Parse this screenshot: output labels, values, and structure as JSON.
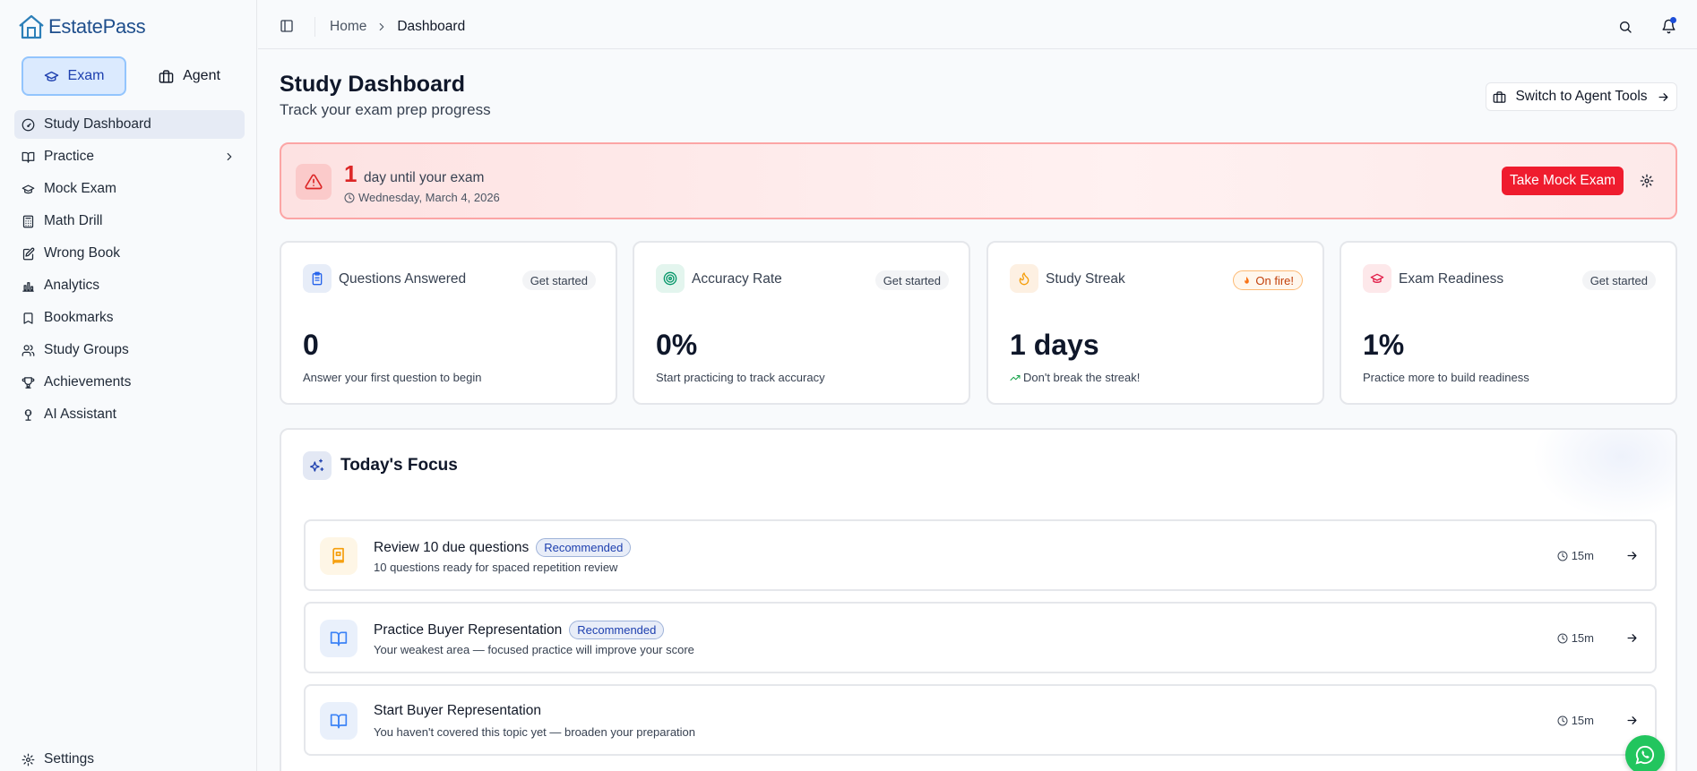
{
  "brand": {
    "name": "EstatePass"
  },
  "mode": {
    "exam_label": "Exam",
    "agent_label": "Agent"
  },
  "sidebar": {
    "items": [
      {
        "label": "Study Dashboard",
        "icon": "gauge-icon"
      },
      {
        "label": "Practice",
        "icon": "book-open-icon"
      },
      {
        "label": "Mock Exam",
        "icon": "graduation-cap-icon"
      },
      {
        "label": "Math Drill",
        "icon": "calculator-icon"
      },
      {
        "label": "Wrong Book",
        "icon": "notebook-pen-icon"
      },
      {
        "label": "Analytics",
        "icon": "bar-chart-icon"
      },
      {
        "label": "Bookmarks",
        "icon": "bookmark-icon"
      },
      {
        "label": "Study Groups",
        "icon": "users-icon"
      },
      {
        "label": "Achievements",
        "icon": "trophy-icon"
      },
      {
        "label": "AI Assistant",
        "icon": "bot-icon"
      }
    ],
    "settings_label": "Settings"
  },
  "breadcrumb": {
    "home": "Home",
    "current": "Dashboard"
  },
  "header": {
    "title": "Study Dashboard",
    "subtitle": "Track your exam prep progress",
    "switch_label": "Switch to Agent Tools"
  },
  "countdown": {
    "days": "1",
    "text": "day until your exam",
    "date": "Wednesday, March 4, 2026",
    "button_label": "Take Mock Exam"
  },
  "stats": [
    {
      "title": "Questions Answered",
      "badge": "Get started",
      "value": "0",
      "desc": "Answer your first question to begin"
    },
    {
      "title": "Accuracy Rate",
      "badge": "Get started",
      "value": "0%",
      "desc": "Start practicing to track accuracy"
    },
    {
      "title": "Study Streak",
      "badge": "On fire!",
      "value": "1 days",
      "desc": "Don't break the streak!"
    },
    {
      "title": "Exam Readiness",
      "badge": "Get started",
      "value": "1%",
      "desc": "Practice more to build readiness"
    }
  ],
  "focus": {
    "title": "Today's Focus",
    "tasks": [
      {
        "title": "Review 10 due questions",
        "badge": "Recommended",
        "desc": "10 questions ready for spaced repetition review",
        "time": "15m"
      },
      {
        "title": "Practice Buyer Representation",
        "badge": "Recommended",
        "desc": "Your weakest area — focused practice will improve your score",
        "time": "15m"
      },
      {
        "title": "Start Buyer Representation",
        "badge": "",
        "desc": "You haven't covered this topic yet — broaden your preparation",
        "time": "15m"
      }
    ]
  },
  "colors": {
    "accent": "#1e40af",
    "danger": "#ef1c2e",
    "streak": "#f97316",
    "success": "#22c55e"
  }
}
